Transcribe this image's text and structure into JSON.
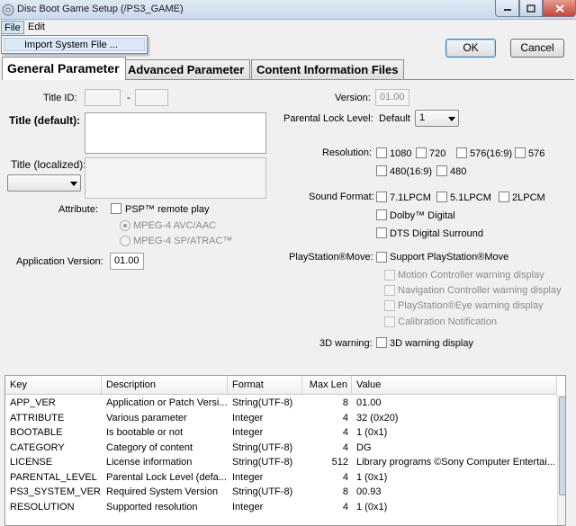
{
  "window": {
    "title": "Disc Boot Game Setup (/PS3_GAME)"
  },
  "menu": {
    "file": "File",
    "edit": "Edit",
    "file_items": [
      "Import System File ..."
    ]
  },
  "buttons": {
    "ok": "OK",
    "cancel": "Cancel"
  },
  "tabs": [
    "General Parameter",
    "Advanced Parameter",
    "Content Information Files"
  ],
  "left": {
    "title_id_label": "Title ID:",
    "title_id_part1": "",
    "title_id_sep": "-",
    "title_id_part2": "",
    "title_default_label": "Title (default):",
    "title_default_value": "",
    "title_localized_label": "Title (localized):",
    "title_localized_lang": "",
    "attribute_label": "Attribute:",
    "psp_remote_play": "PSP™ remote play",
    "mpeg4_avc": "MPEG-4 AVC/AAC",
    "mpeg4_sp": "MPEG-4 SP/ATRAC™",
    "app_version_label": "Application Version:",
    "app_version_value": "01.00"
  },
  "right": {
    "version_label": "Version:",
    "version_value": "01.00",
    "parental_label": "Parental Lock Level:",
    "parental_default": "Default",
    "parental_value": "1",
    "resolution_label": "Resolution:",
    "resolutions": [
      "1080",
      "720",
      "576(16:9)",
      "576",
      "480(16:9)",
      "480"
    ],
    "sound_label": "Sound Format:",
    "sound_formats": [
      "7.1LPCM",
      "5.1LPCM",
      "2LPCM",
      "Dolby™ Digital",
      "DTS Digital Surround"
    ],
    "move_label": "PlayStation®Move:",
    "move_support": "Support PlayStation®Move",
    "move_options": [
      "Motion Controller warning display",
      "Navigation Controller warning display",
      "PlayStation®Eye warning display",
      "Calibration Notification"
    ],
    "warning3d_label": "3D warning:",
    "warning3d_option": "3D warning display"
  },
  "table": {
    "headers": [
      "Key",
      "Description",
      "Format",
      "Max Len",
      "Value"
    ],
    "rows": [
      [
        "APP_VER",
        "Application or Patch Versi...",
        "String(UTF-8)",
        "8",
        "01.00"
      ],
      [
        "ATTRIBUTE",
        "Various parameter",
        "Integer",
        "4",
        "32 (0x20)"
      ],
      [
        "BOOTABLE",
        "Is bootable or not",
        "Integer",
        "4",
        "1 (0x1)"
      ],
      [
        "CATEGORY",
        "Category of content",
        "String(UTF-8)",
        "4",
        "DG"
      ],
      [
        "LICENSE",
        "License information",
        "String(UTF-8)",
        "512",
        "Library programs ©Sony Computer Entertai..."
      ],
      [
        "PARENTAL_LEVEL",
        "Parental Lock Level (defa...",
        "Integer",
        "4",
        "1 (0x1)"
      ],
      [
        "PS3_SYSTEM_VER",
        "Required System Version",
        "String(UTF-8)",
        "8",
        "00.93"
      ],
      [
        "RESOLUTION",
        "Supported resolution",
        "Integer",
        "4",
        "1 (0x1)"
      ]
    ]
  }
}
